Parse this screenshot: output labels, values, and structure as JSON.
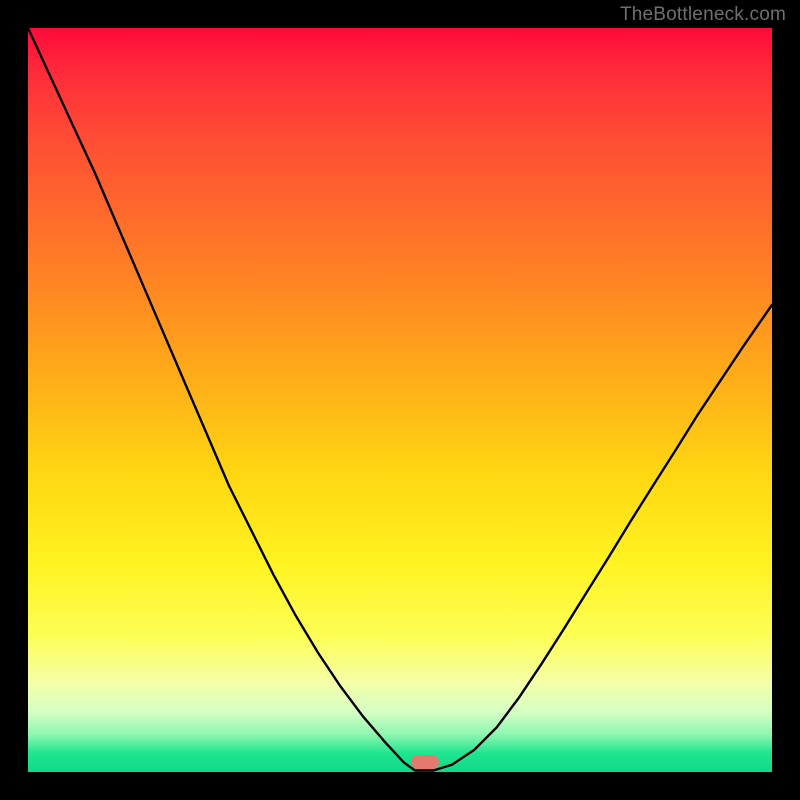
{
  "watermark": "TheBottleneck.com",
  "marker": {
    "x_frac": 0.534,
    "y_frac": 0.986,
    "color": "#e5796f"
  },
  "chart_data": {
    "type": "line",
    "title": "",
    "xlabel": "",
    "ylabel": "",
    "xlim": [
      0,
      1
    ],
    "ylim": [
      0,
      1
    ],
    "series": [
      {
        "name": "curve",
        "x": [
          0.0,
          0.03,
          0.06,
          0.09,
          0.12,
          0.15,
          0.18,
          0.21,
          0.24,
          0.27,
          0.3,
          0.33,
          0.36,
          0.39,
          0.42,
          0.45,
          0.48,
          0.505,
          0.52,
          0.545,
          0.57,
          0.6,
          0.63,
          0.66,
          0.69,
          0.72,
          0.75,
          0.78,
          0.81,
          0.84,
          0.87,
          0.9,
          0.93,
          0.96,
          1.0
        ],
        "y": [
          1.0,
          0.935,
          0.87,
          0.805,
          0.735,
          0.665,
          0.595,
          0.525,
          0.455,
          0.385,
          0.325,
          0.265,
          0.21,
          0.16,
          0.115,
          0.075,
          0.04,
          0.013,
          0.002,
          0.002,
          0.01,
          0.03,
          0.06,
          0.1,
          0.145,
          0.192,
          0.24,
          0.288,
          0.337,
          0.385,
          0.432,
          0.48,
          0.525,
          0.57,
          0.628
        ]
      }
    ],
    "gradient_stops": [
      {
        "pos": 0.0,
        "color": "#ff0a3a"
      },
      {
        "pos": 0.25,
        "color": "#ff6a2c"
      },
      {
        "pos": 0.5,
        "color": "#ffb018"
      },
      {
        "pos": 0.72,
        "color": "#fff321"
      },
      {
        "pos": 0.88,
        "color": "#f4ffa8"
      },
      {
        "pos": 1.0,
        "color": "#12d98a"
      }
    ],
    "marker": {
      "x": 0.534,
      "y": 0.014
    }
  }
}
